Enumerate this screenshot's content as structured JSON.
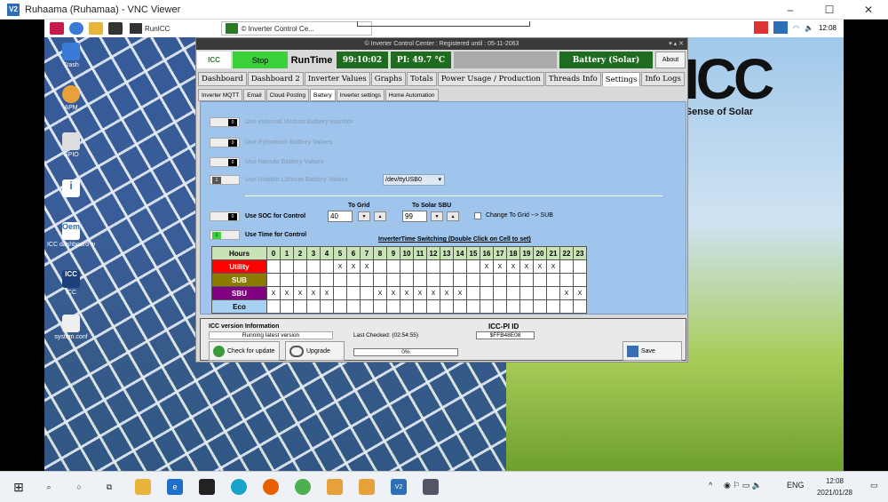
{
  "vnc": {
    "title": "Ruhaama (Ruhamaa) - VNC Viewer",
    "logo": "V2"
  },
  "pi_taskbar": {
    "runicc": "RunICC",
    "window_task": "© Inverter Control Ce...",
    "clock": "12:08"
  },
  "desktop_icons": [
    "Trash",
    "APM",
    "GPIO",
    "",
    "ICC dashboard w",
    "ICC",
    "system.conf"
  ],
  "brand": {
    "name": "ICC",
    "slogan": "g Sense of Solar"
  },
  "app": {
    "title": "© Inverter Control Center : Registered until : 05-11-2063",
    "stop_label": "Stop",
    "runtime_label": "RunTime",
    "runtime_value": "99:10:02",
    "pi_temp": "PI: 49.7 °C",
    "battery_mode": "Battery (Solar)",
    "about": "About",
    "tabs": [
      "Dashboard",
      "Dashboard 2",
      "Inverter Values",
      "Graphs",
      "Totals",
      "Power Usage / Production",
      "Threads Info",
      "Settings",
      "Info Logs"
    ],
    "active_tab": "Settings",
    "subtabs": [
      "Inverter  MQTT",
      "Email",
      "Cloud Posting",
      "Battery",
      "Inverter settings",
      "Home Automation"
    ],
    "active_subtab": "Battery",
    "options": {
      "victron": "Use external Victron Battery monitor",
      "pylontech": "Use Pylontech Battery Values",
      "narada": "Use Narada Battery Values",
      "hubble": "Use Hubble Lithium Battery Values",
      "device": "/dev/ttyUSB0",
      "soc": "Use SOC for Control",
      "time": "Use Time for Control"
    },
    "to_grid_label": "To Grid",
    "to_grid_value": "40",
    "to_solar_label": "To Solar SBU",
    "to_solar_value": "99",
    "change_to_grid": "Change To Grid --> SUB",
    "grid_title": "InverterTime Switching  (Double Click on Cell to set)",
    "hours_label": "Hours",
    "hours": [
      "0",
      "1",
      "2",
      "3",
      "4",
      "5",
      "6",
      "7",
      "8",
      "9",
      "10",
      "11",
      "12",
      "13",
      "14",
      "15",
      "16",
      "17",
      "18",
      "19",
      "20",
      "21",
      "22",
      "23"
    ],
    "rows": [
      {
        "name": "Utility",
        "color": "#ff0000",
        "text_color": "#ffffff",
        "x": [
          5,
          6,
          7,
          16,
          17,
          18,
          19,
          20,
          21
        ]
      },
      {
        "name": "SUB",
        "color": "#8a7a00",
        "text_color": "#ffffff",
        "x": []
      },
      {
        "name": "SBU",
        "color": "#800080",
        "text_color": "#ffffff",
        "x": [
          0,
          1,
          2,
          3,
          4,
          8,
          9,
          10,
          11,
          12,
          13,
          14,
          22,
          23
        ]
      },
      {
        "name": "Eco",
        "color": "#a8d0f0",
        "text_color": "#000000",
        "x": []
      }
    ],
    "version_header": "ICC version Information",
    "version_status": "Running latest version",
    "last_checked": "Last Checked: (02:54:55)",
    "pi_id_header": "ICC-PI ID",
    "pi_id": "$FFB48E08",
    "check_update": "Check for update",
    "upgrade": "Upgrade",
    "progress": "0%",
    "save": "Save"
  },
  "win_taskbar": {
    "lang": "ENG",
    "time": "12:08",
    "date": "2021/01/28"
  }
}
